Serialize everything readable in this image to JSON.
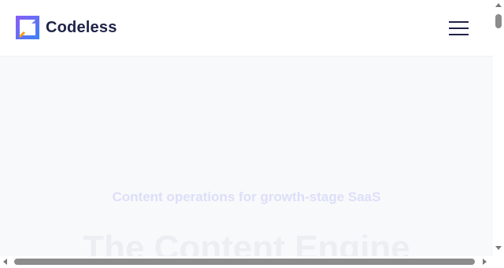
{
  "navbar": {
    "brand_name": "Codeless",
    "logo_icon": "codeless-logo-icon",
    "menu_icon": "hamburger-menu-icon"
  },
  "hero": {
    "tagline": "Content operations for growth-stage SaaS",
    "headline": "The Content Engine"
  },
  "colors": {
    "brand_text": "#1f2347",
    "logo_gradient_start": "#8b5cf6",
    "logo_gradient_end": "#3b82f6",
    "logo_accent": "#f59e0b",
    "page_background": "#f8f9fb"
  },
  "scrollbars": {
    "vertical": {
      "up_icon": "arrow-up-icon",
      "down_icon": "arrow-down-icon"
    },
    "horizontal": {
      "left_icon": "arrow-left-icon",
      "right_icon": "arrow-right-icon"
    }
  }
}
